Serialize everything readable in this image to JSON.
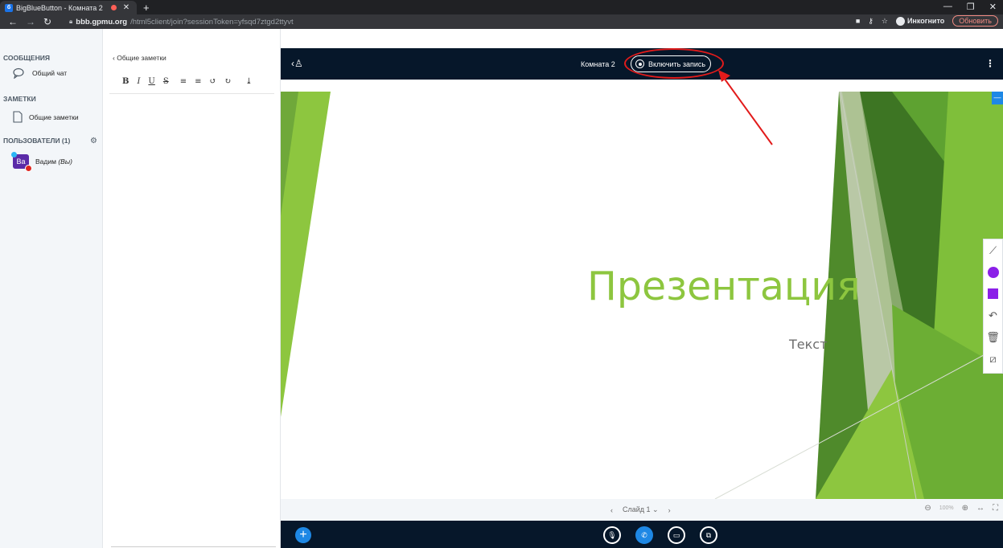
{
  "browser": {
    "tab_title": "BigBlueButton - Комната 2",
    "favicon": "б",
    "url_host": "bbb.gpmu.org",
    "url_path": "/html5client/join?sessionToken=yfsqd7ztgd2ttyvt",
    "incognito_label": "Инкогнито",
    "update_label": "Обновить"
  },
  "sidebar": {
    "messages_title": "СООБЩЕНИЯ",
    "public_chat": "Общий чат",
    "notes_title": "ЗАМЕТКИ",
    "shared_notes": "Общие заметки",
    "users_title": "ПОЛЬЗОВАТЕЛИ (1)",
    "user_initials": "Ва",
    "user_name": "Вадим",
    "user_you": "(Вы)"
  },
  "notes_panel": {
    "back_label": "Общие заметки",
    "toolbar": [
      "B",
      "I",
      "U",
      "S",
      "≡",
      "≡",
      "↺",
      "↻",
      "⤓"
    ]
  },
  "topbar": {
    "room_name": "Комната 2",
    "record_label": "Включить запись"
  },
  "slide": {
    "title": "Презентация",
    "subtitle": "Текст",
    "slide_label": "Слайд 1",
    "zoom": "100%"
  },
  "colors": {
    "accent_green": "#8dc63f",
    "dark_navy": "#06172a",
    "primary_blue": "#1e88e5",
    "annotation_red": "#e21b1b",
    "tool_purple": "#8b1fe8"
  }
}
